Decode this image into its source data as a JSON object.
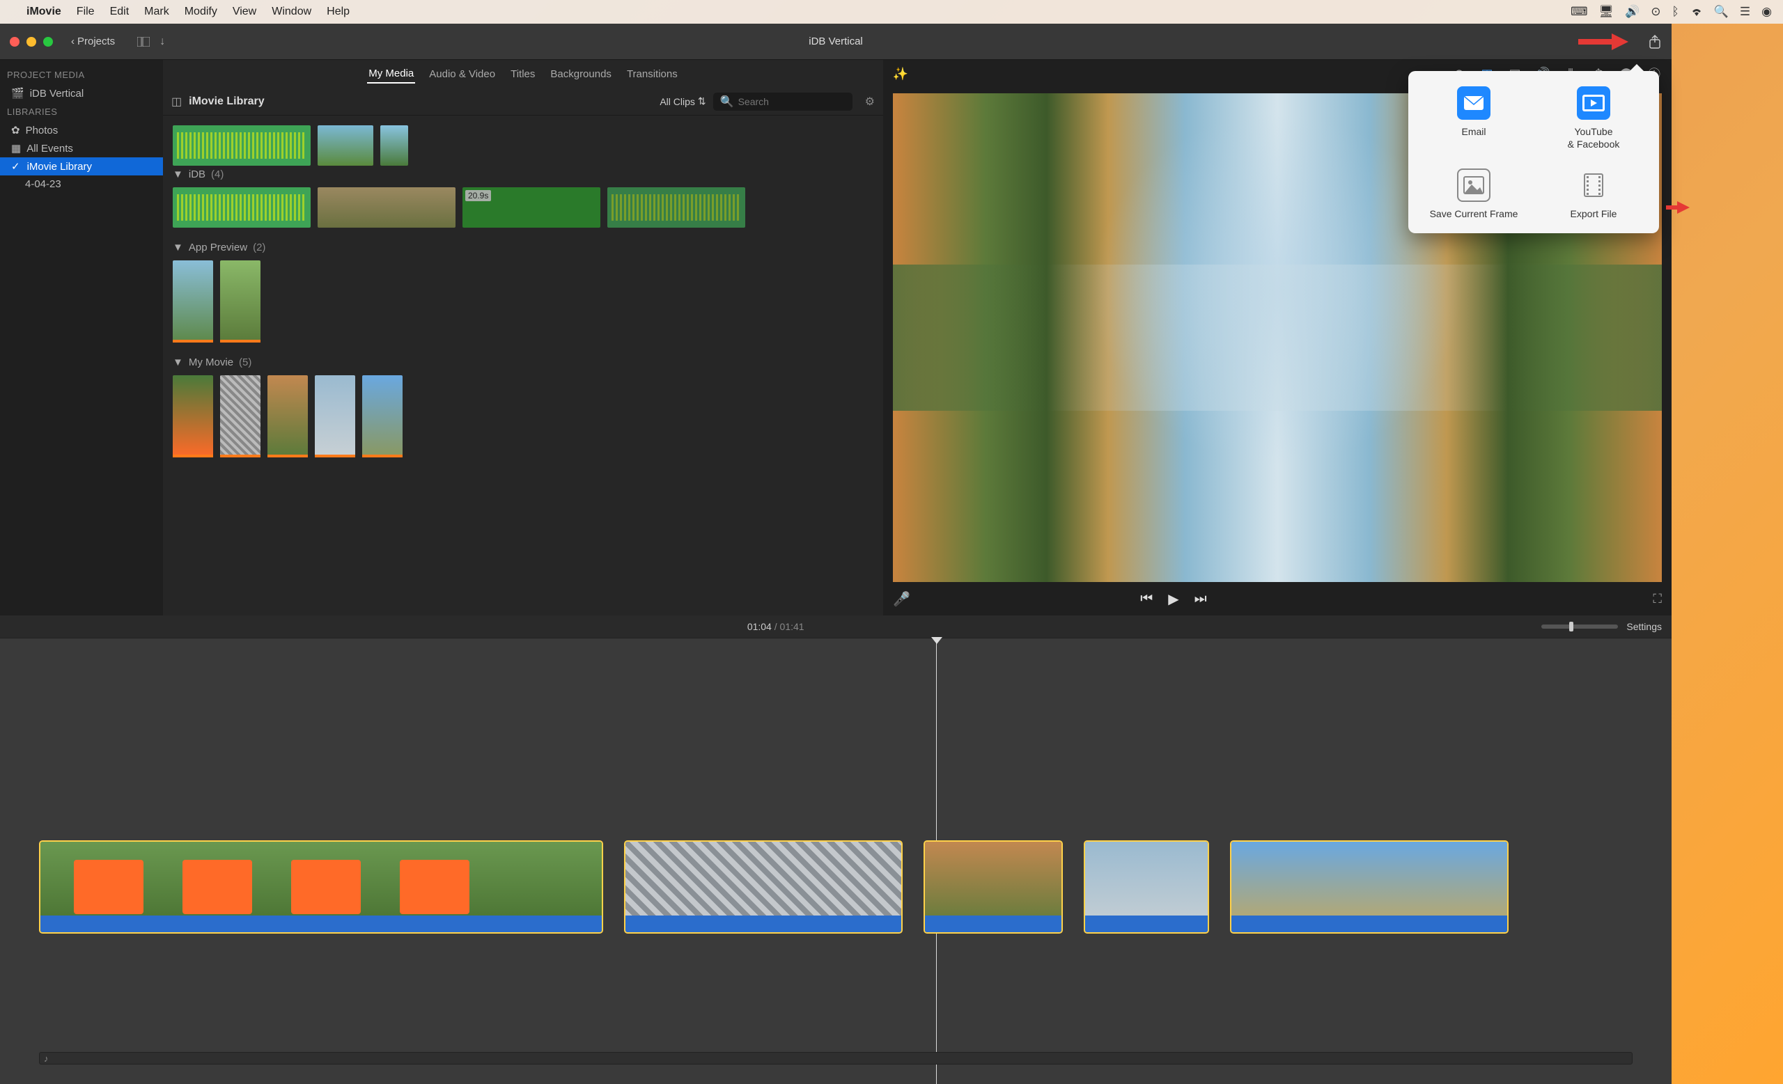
{
  "menubar": {
    "app": "iMovie",
    "items": [
      "File",
      "Edit",
      "Mark",
      "Modify",
      "View",
      "Window",
      "Help"
    ]
  },
  "window": {
    "projects_label": "Projects",
    "title": "iDB Vertical"
  },
  "share_popover": {
    "email": "Email",
    "youtube": "YouTube\n& Facebook",
    "save_frame": "Save Current Frame",
    "export_file": "Export File"
  },
  "sidebar": {
    "project_media_label": "PROJECT MEDIA",
    "project_name": "iDB Vertical",
    "libraries_label": "LIBRARIES",
    "photos": "Photos",
    "all_events": "All Events",
    "imovie_library": "iMovie Library",
    "date_event": "4-04-23"
  },
  "media_tabs": {
    "my_media": "My Media",
    "audio_video": "Audio & Video",
    "titles": "Titles",
    "backgrounds": "Backgrounds",
    "transitions": "Transitions"
  },
  "media_header": {
    "library_name": "iMovie Library",
    "all_clips": "All Clips",
    "search_placeholder": "Search"
  },
  "media_groups": {
    "idb": {
      "name": "iDB",
      "count": "(4)",
      "badge": "20.9s"
    },
    "app_preview": {
      "name": "App Preview",
      "count": "(2)"
    },
    "my_movie": {
      "name": "My Movie",
      "count": "(5)"
    }
  },
  "timeline": {
    "current": "01:04",
    "total": "01:41",
    "settings": "Settings"
  }
}
